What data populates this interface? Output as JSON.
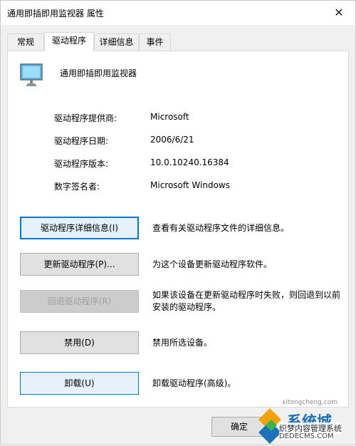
{
  "window": {
    "title": "通用即插即用监视器 属性",
    "close_glyph": "✕"
  },
  "tabs": [
    {
      "label": "常规",
      "active": false
    },
    {
      "label": "驱动程序",
      "active": true
    },
    {
      "label": "详细信息",
      "active": false
    },
    {
      "label": "事件",
      "active": false
    }
  ],
  "device": {
    "name": "通用即插即用监视器",
    "icon": "monitor-icon"
  },
  "info": [
    {
      "label": "驱动程序提供商:",
      "value": "Microsoft"
    },
    {
      "label": "驱动程序日期:",
      "value": "2006/6/21"
    },
    {
      "label": "驱动程序版本:",
      "value": "10.0.10240.16384"
    },
    {
      "label": "数字签名者:",
      "value": "Microsoft Windows"
    }
  ],
  "actions": [
    {
      "button": "驱动程序详细信息(I)",
      "description": "查看有关驱动程序文件的详细信息。",
      "state": "focused"
    },
    {
      "button": "更新驱动程序(P)...",
      "description": "为这个设备更新驱动程序软件。",
      "state": "normal"
    },
    {
      "button": "回退驱动程序(R)",
      "description": "如果该设备在更新驱动程序时失败，则回退到以前安装的驱动程序。",
      "state": "disabled"
    },
    {
      "button": "禁用(D)",
      "description": "禁用所选设备。",
      "state": "normal"
    },
    {
      "button": "卸载(U)",
      "description": "卸载驱动程序(高级)。",
      "state": "hover"
    }
  ],
  "footer": {
    "ok_label": "确定"
  },
  "watermark": {
    "site_name": "系统城",
    "sub_text": "xitongcheng.com",
    "slogan": "织梦内容管理系统",
    "domain": "DEDECMS.COM"
  },
  "colors": {
    "accent": "#0078d7",
    "window_bg": "#f0f0f0",
    "panel_bg": "#ffffff",
    "button_bg": "#e1e1e1"
  }
}
